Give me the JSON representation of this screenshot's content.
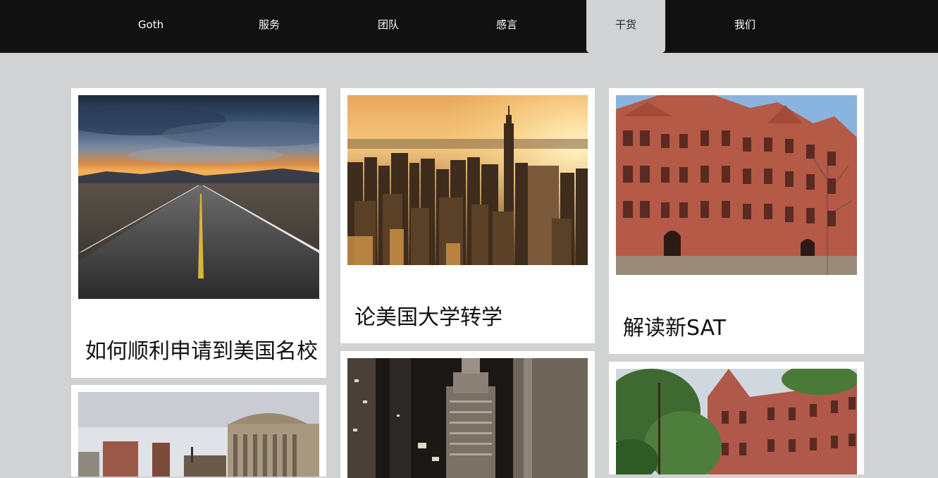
{
  "nav": {
    "items": [
      {
        "label": "Goth",
        "active": false
      },
      {
        "label": "服务",
        "active": false
      },
      {
        "label": "团队",
        "active": false
      },
      {
        "label": "感言",
        "active": false
      },
      {
        "label": "干货",
        "active": true
      },
      {
        "label": "我们",
        "active": false
      }
    ]
  },
  "cards": [
    {
      "title": "如何顺利申请到美国名校"
    },
    {
      "title": "论美国大学转学"
    },
    {
      "title": "解读新SAT"
    },
    {
      "title": ""
    },
    {
      "title": ""
    },
    {
      "title": ""
    }
  ],
  "colors": {
    "nav_bg": "#111111",
    "page_bg": "#d1d2d4",
    "card_bg": "#ffffff"
  }
}
